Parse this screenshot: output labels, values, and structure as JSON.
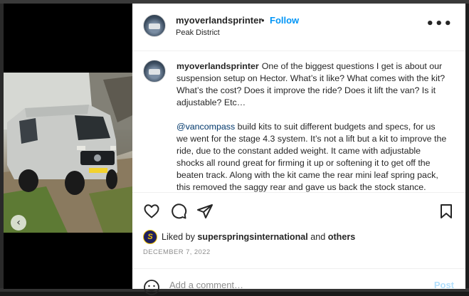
{
  "post": {
    "username": "myoverlandsprinter",
    "separator": "•",
    "follow_label": "Follow",
    "location": "Peak District",
    "more_icon": "more-horizontal-icon",
    "more_label": "•••"
  },
  "caption": {
    "username": "myoverlandsprinter",
    "paragraph1": "One of the biggest questions I get is about our suspension setup on Hector. What’s it like? What comes with the kit? What’s the cost? Does it improve the ride? Does it lift the van? Is it adjustable? Etc…",
    "mention": "@vancompass",
    "paragraph2": " build kits to suit different budgets and specs, for us we went for the stage 4.3 system. It’s not a lift but a kit to improve the ride, due to the constant added weight. It came with adjustable shocks all round great for firming it up or softening it to get off the beaten track. Along with the kit came the rear mini leaf spring pack, this removed the saggy rear and gave us back the stock stance."
  },
  "media": {
    "prev_arrow": "‹",
    "carousel_count": 3,
    "carousel_active": 2,
    "plate": "J0N W8"
  },
  "actions": {
    "liked_prefix": "Liked by ",
    "liked_user": "superspringsinternational",
    "liked_mid": " and ",
    "liked_others": "others",
    "liked_avatar_letter": "S",
    "date": "DECEMBER 7, 2022"
  },
  "comment": {
    "placeholder": "Add a comment…",
    "post_label": "Post"
  },
  "colors": {
    "accent": "#0095f6",
    "post_disabled": "#b2dffc",
    "mention": "#00376b",
    "muted": "#8e8e8e"
  }
}
